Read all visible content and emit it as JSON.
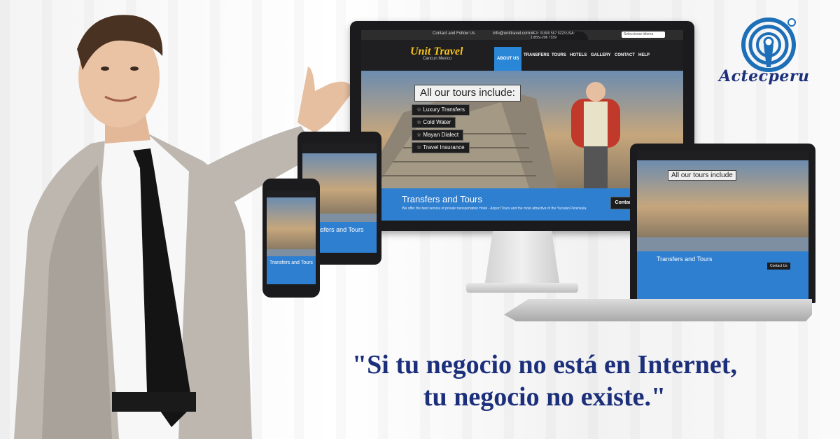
{
  "logo": {
    "text": "Actecperu"
  },
  "monitor": {
    "topbar": {
      "follow": "Contact and Follow Us",
      "mail": "info@unittravel.com",
      "phone": "MEX: 01800 567 9223  USA: 1(855)-296 7339",
      "language": "Seleccionar idioma"
    },
    "brand": {
      "name": "Unit Travel",
      "subtitle": "Cancun Mexico"
    },
    "nav": [
      "ABOUT US",
      "TRANSFERS",
      "TOURS",
      "HOTELS",
      "GALLERY",
      "CONTACT",
      "HELP"
    ],
    "hero_title": "All our tours include:",
    "tours": [
      "Luxury Transfers",
      "Cold Water",
      "Mayan Dialect",
      "Travel Insurance"
    ],
    "band_title": "Transfers and Tours",
    "band_text": "We offer the best service of private transportation Hotel - Airport Tours and the most attractive of the Yucatan Peninsula.",
    "contact_button": "Contact Us"
  },
  "laptop": {
    "hero_title": "All our tours include",
    "band_title": "Transfers and Tours",
    "contact_button": "Contact Us"
  },
  "tablet": {
    "band_title": "Transfers and Tours"
  },
  "phone": {
    "band_title": "Transfers and Tours"
  },
  "quote": {
    "line1": "\"Si tu negocio no está en Internet,",
    "line2": "tu negocio no existe.\""
  },
  "colors": {
    "brand_blue": "#2f7fd0",
    "quote_navy": "#1c2f7a",
    "logo_blue": "#1d6fb8"
  }
}
